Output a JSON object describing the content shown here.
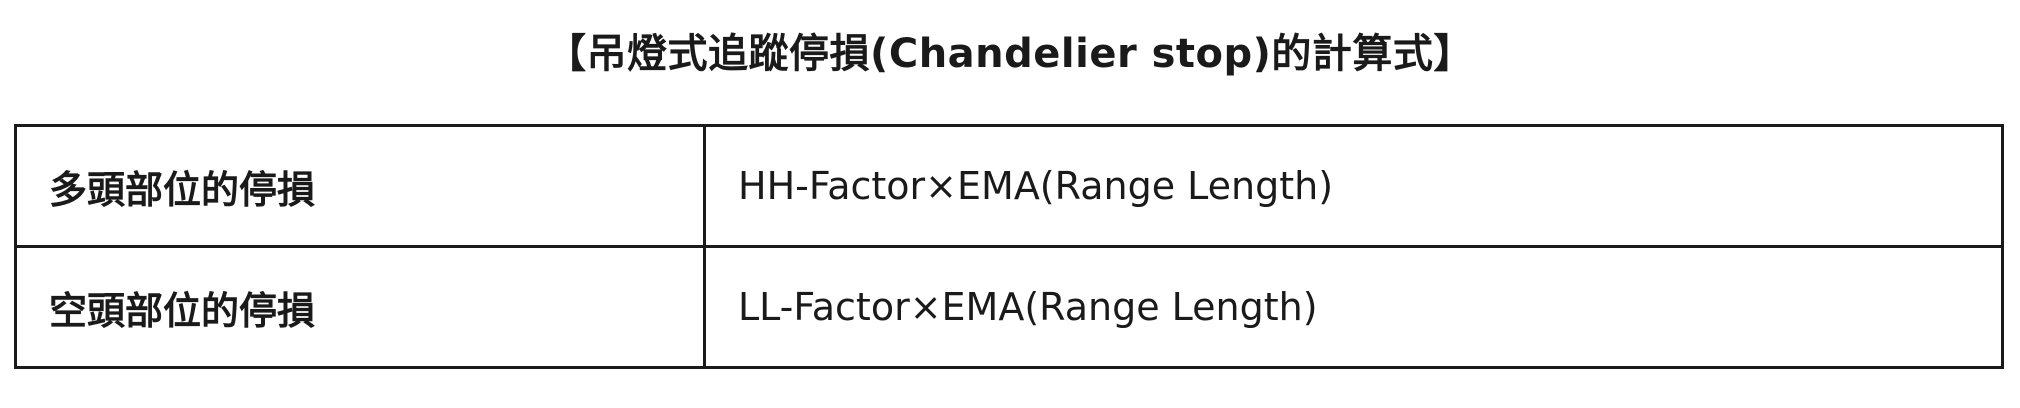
{
  "title": "【吊燈式追蹤停損(Chandelier stop)的計算式】",
  "rows": [
    {
      "label": "多頭部位的停損",
      "formula": "HH-Factor×EMA(Range Length)"
    },
    {
      "label": "空頭部位的停損",
      "formula": "LL-Factor×EMA(Range Length)"
    }
  ]
}
